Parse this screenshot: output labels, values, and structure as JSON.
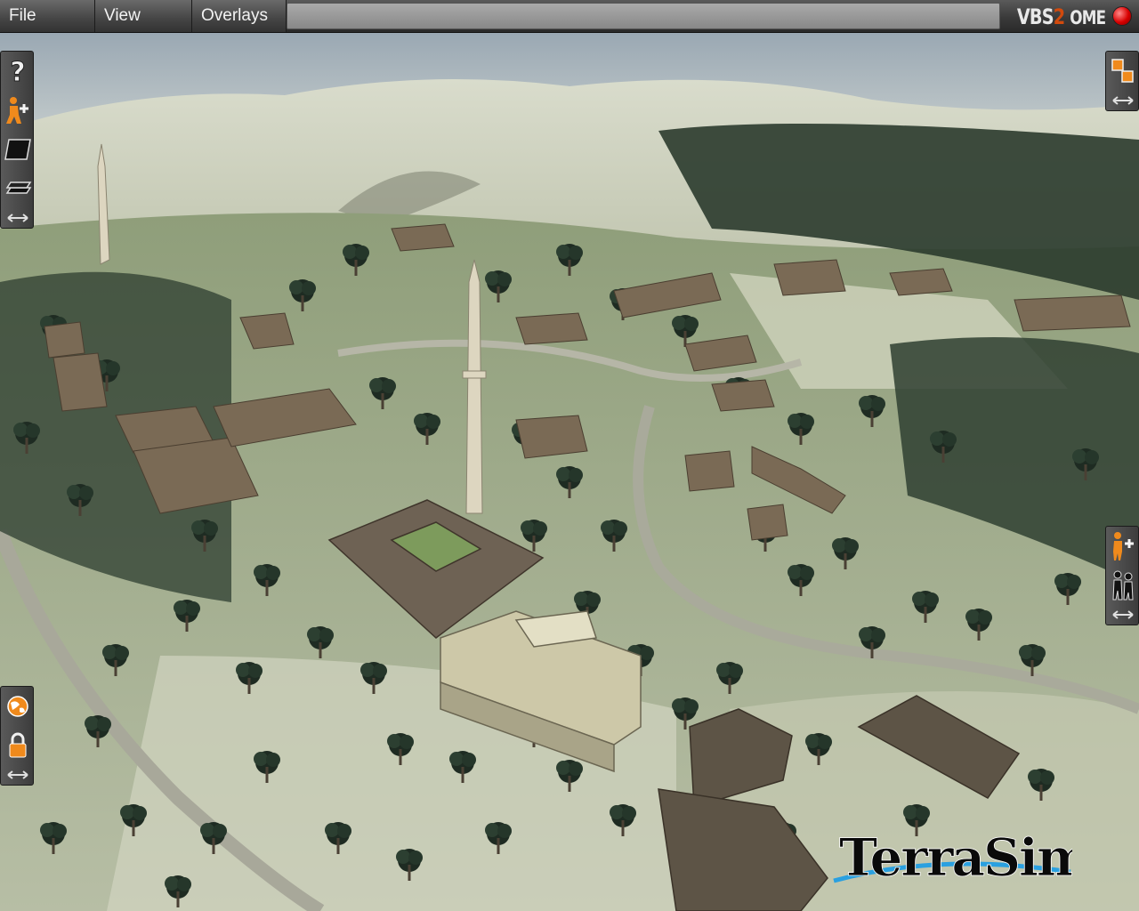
{
  "menubar": {
    "items": [
      {
        "label": "File"
      },
      {
        "label": "View"
      },
      {
        "label": "Overlays"
      }
    ],
    "brand": {
      "vbs": "VBS",
      "two": "2",
      "ome": "OME"
    },
    "accent_color": "#d24a0d",
    "record_color": "#d80000"
  },
  "toolbars": {
    "left_top": [
      "help-icon",
      "add-unit-icon",
      "layer-icon",
      "layers-stack-icon"
    ],
    "right_top": [
      "windows-icon"
    ],
    "right_mid": [
      "add-unit-icon",
      "group-people-icon"
    ],
    "left_bottom": [
      "globe-icon",
      "lock-icon"
    ]
  },
  "logo": {
    "text": "TerraSim"
  }
}
